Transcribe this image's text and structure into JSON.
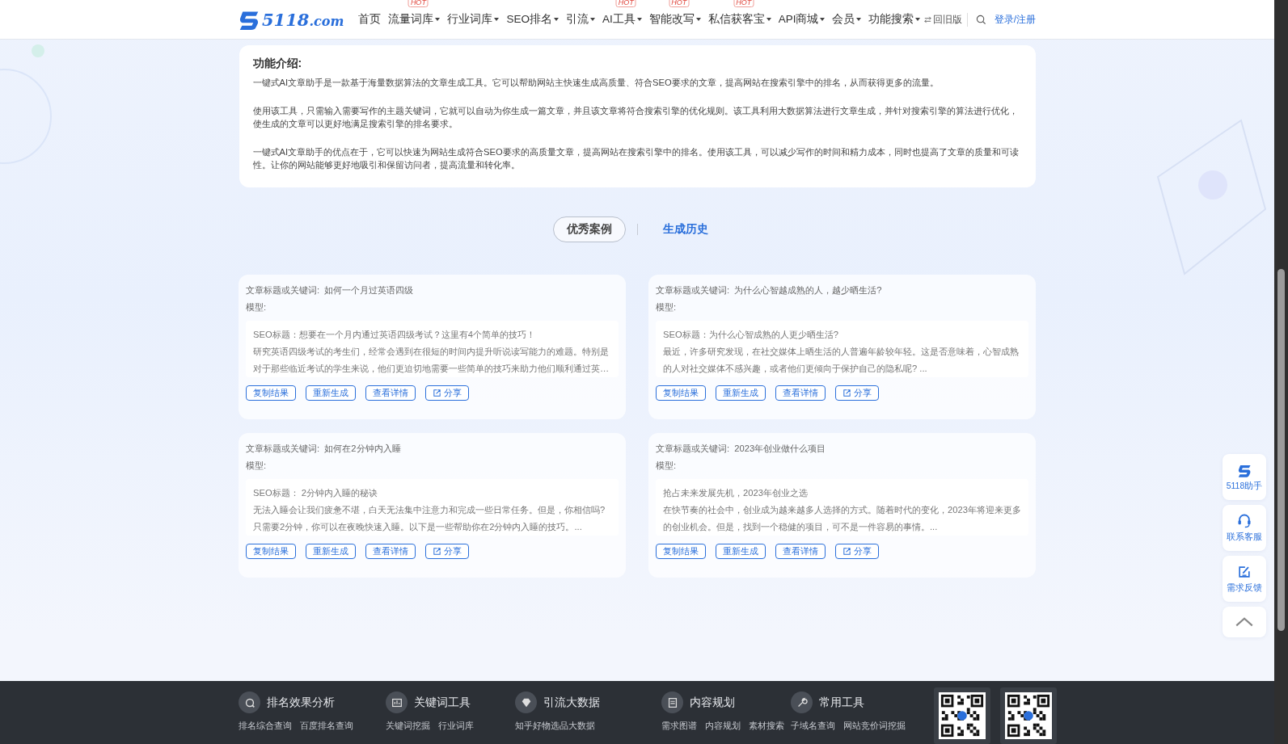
{
  "header": {
    "logo": {
      "name": "5118",
      "suffix": ".com"
    },
    "nav": [
      {
        "label": "首页",
        "dropdown": false
      },
      {
        "label": "流量词库",
        "dropdown": true,
        "badge": "HOT"
      },
      {
        "label": "行业词库",
        "dropdown": true
      },
      {
        "label": "SEO排名",
        "dropdown": true
      },
      {
        "label": "引流",
        "dropdown": true
      },
      {
        "label": "AI工具",
        "dropdown": true,
        "badge": "HOT"
      },
      {
        "label": "智能改写",
        "dropdown": true,
        "badge": "HOT"
      },
      {
        "label": "私信获客宝",
        "dropdown": true,
        "badge": "HOT"
      },
      {
        "label": "API商城",
        "dropdown": true
      },
      {
        "label": "会员",
        "dropdown": true
      },
      {
        "label": "功能搜索",
        "dropdown": true
      }
    ],
    "old_version": "回旧版",
    "login": "登录/注册"
  },
  "intro": {
    "title": "功能介绍:",
    "paragraphs": [
      "一键式AI文章助手是一款基于海量数据算法的文章生成工具。它可以帮助网站主快速生成高质量、符合SEO要求的文章，提高网站在搜索引擎中的排名，从而获得更多的流量。",
      "使用该工具，只需输入需要写作的主题关键词，它就可以自动为你生成一篇文章，并且该文章将符合搜索引擎的优化规则。该工具利用大数据算法进行文章生成，并针对搜索引擎的算法进行优化，使生成的文章可以更好地满足搜索引擎的排名要求。",
      "一键式AI文章助手的优点在于，它可以快速为网站生成符合SEO要求的高质量文章，提高网站在搜索引擎中的排名。使用该工具，可以减少写作的时间和精力成本，同时也提高了文章的质量和可读性。让你的网站能够更好地吸引和保留访问者，提高流量和转化率。"
    ]
  },
  "tabs": [
    {
      "label": "优秀案例",
      "selected": true
    },
    {
      "label": "生成历史",
      "selected": false
    }
  ],
  "cases": [
    {
      "keyword_label": "文章标题或关键词:",
      "keyword": "如何一个月过英语四级",
      "model_label": "模型:",
      "seo_title": "SEO标题：想要在一个月内通过英语四级考试？这里有4个简单的技巧！",
      "body": "研究英语四级考试的考生们，经常会遇到在很短的时间内提升听说读写能力的难题。特别是对于那些临近考试的学生来说，他们更迫切地需要一些简单的技巧来助力他们顺利通过英…",
      "actions": [
        {
          "kind": "copy",
          "label": "复制结果"
        },
        {
          "kind": "regen",
          "label": "重新生成"
        },
        {
          "kind": "detail",
          "label": "查看详情"
        },
        {
          "kind": "share",
          "label": "分享"
        }
      ]
    },
    {
      "keyword_label": "文章标题或关键词:",
      "keyword": "为什么心智越成熟的人，越少晒生活?",
      "model_label": "模型:",
      "seo_title": "SEO标题：为什么心智成熟的人更少晒生活?",
      "body": "最近，许多研究发现，在社交媒体上晒生活的人普遍年龄较年轻。这是否意味着，心智成熟的人对社交媒体不感兴趣，或者他们更倾向于保护自己的隐私呢? ...",
      "actions": [
        {
          "kind": "copy",
          "label": "复制结果"
        },
        {
          "kind": "regen",
          "label": "重新生成"
        },
        {
          "kind": "detail",
          "label": "查看详情"
        },
        {
          "kind": "share",
          "label": "分享"
        }
      ]
    },
    {
      "keyword_label": "文章标题或关键词:",
      "keyword": "如何在2分钟内入睡",
      "model_label": "模型:",
      "seo_title": "SEO标题： 2分钟内入睡的秘诀",
      "body": "无法入睡会让我们疲惫不堪，白天无法集中注意力和完成一些日常任务。但是，你相信吗? 只需要2分钟，你可以在夜晚快速入睡。以下是一些帮助你在2分钟内入睡的技巧。...",
      "actions": [
        {
          "kind": "copy",
          "label": "复制结果"
        },
        {
          "kind": "regen",
          "label": "重新生成"
        },
        {
          "kind": "detail",
          "label": "查看详情"
        },
        {
          "kind": "share",
          "label": "分享"
        }
      ]
    },
    {
      "keyword_label": "文章标题或关键词:",
      "keyword": "2023年创业做什么项目",
      "model_label": "模型:",
      "seo_title": "抢占未来发展先机，2023年创业之选",
      "body": "在快节奏的社会中，创业成为越来越多人选择的方式。随着时代的变化，2023年将迎来更多的创业机会。但是，找到一个稳健的项目，可不是一件容易的事情。...",
      "actions": [
        {
          "kind": "copy",
          "label": "复制结果"
        },
        {
          "kind": "regen",
          "label": "重新生成"
        },
        {
          "kind": "detail",
          "label": "查看详情"
        },
        {
          "kind": "share",
          "label": "分享"
        }
      ]
    }
  ],
  "side_buttons": [
    {
      "kind": "assistant",
      "label": "5118助手"
    },
    {
      "kind": "service",
      "label": "联系客服"
    },
    {
      "kind": "feedback",
      "label": "需求反馈"
    },
    {
      "kind": "top"
    }
  ],
  "footer": {
    "sections": [
      {
        "kind": "rank",
        "title": "排名效果分析",
        "links": [
          "排名综合查询",
          "百度排名查询"
        ]
      },
      {
        "kind": "keyword",
        "title": "关键词工具",
        "links": [
          "关键词挖掘",
          "行业词库"
        ]
      },
      {
        "kind": "traffic",
        "title": "引流大数据",
        "links": [
          "知乎好物选品大数据"
        ]
      },
      {
        "kind": "content",
        "title": "内容规划",
        "links": [
          "需求图谱",
          "内容规划",
          "素材搜索"
        ]
      },
      {
        "kind": "tools",
        "title": "常用工具",
        "links": [
          "子域名查询",
          "网站竞价词挖掘"
        ]
      }
    ],
    "qr_codes": [
      {
        "kind": "qr"
      },
      {
        "kind": "qr"
      }
    ]
  }
}
